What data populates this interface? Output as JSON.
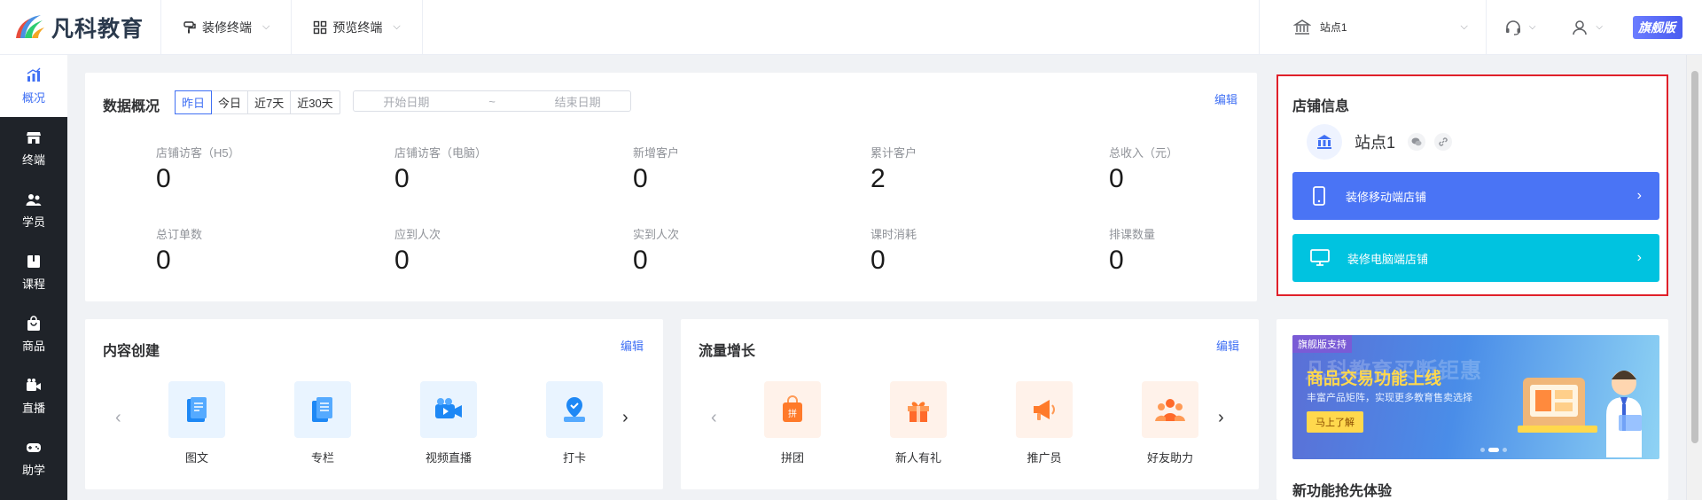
{
  "topbar": {
    "logo_text": "凡科教育",
    "menu_decorate": "装修终端",
    "menu_preview": "预览终端",
    "site": "站点1",
    "vip": "旗舰版"
  },
  "sidebar": {
    "items": [
      {
        "label": "概况",
        "icon": "chart-icon"
      },
      {
        "label": "终端",
        "icon": "store-icon"
      },
      {
        "label": "学员",
        "icon": "users-icon"
      },
      {
        "label": "课程",
        "icon": "book-icon"
      },
      {
        "label": "商品",
        "icon": "bag-icon"
      },
      {
        "label": "直播",
        "icon": "video-icon"
      },
      {
        "label": "助学",
        "icon": "gamepad-icon"
      }
    ]
  },
  "overview": {
    "title": "数据概况",
    "edit": "编辑",
    "ranges": [
      "昨日",
      "今日",
      "近7天",
      "近30天"
    ],
    "active_range": "昨日",
    "start_placeholder": "开始日期",
    "separator": "~",
    "end_placeholder": "结束日期",
    "stats": [
      {
        "label": "店铺访客（H5）",
        "value": "0"
      },
      {
        "label": "店铺访客（电脑）",
        "value": "0"
      },
      {
        "label": "新增客户",
        "value": "0"
      },
      {
        "label": "累计客户",
        "value": "2"
      },
      {
        "label": "总收入（元）",
        "value": "0"
      },
      {
        "label": "总订单数",
        "value": "0"
      },
      {
        "label": "应到人次",
        "value": "0"
      },
      {
        "label": "实到人次",
        "value": "0"
      },
      {
        "label": "课时消耗",
        "value": "0"
      },
      {
        "label": "排课数量",
        "value": "0"
      }
    ]
  },
  "store": {
    "title": "店铺信息",
    "name": "站点1",
    "mobile_btn": "装修移动端店铺",
    "pc_btn": "装修电脑端店铺"
  },
  "content": {
    "title": "内容创建",
    "edit": "编辑",
    "items": [
      {
        "label": "图文",
        "icon": "article-icon"
      },
      {
        "label": "专栏",
        "icon": "column-icon"
      },
      {
        "label": "视频直播",
        "icon": "video-live-icon"
      },
      {
        "label": "打卡",
        "icon": "checkin-icon"
      }
    ]
  },
  "traffic": {
    "title": "流量增长",
    "edit": "编辑",
    "items": [
      {
        "label": "拼团",
        "icon": "group-buy-icon"
      },
      {
        "label": "新人有礼",
        "icon": "gift-icon"
      },
      {
        "label": "推广员",
        "icon": "megaphone-icon"
      },
      {
        "label": "好友助力",
        "icon": "friends-icon"
      }
    ]
  },
  "promo": {
    "tag": "旗舰版支持",
    "ghost": "凡科教育买断钜惠",
    "headline": "商品交易功能上线",
    "sub": "丰富产品矩阵，实现更多教育售卖选择",
    "cta": "马上了解",
    "title": "新功能抢先体验"
  },
  "colors": {
    "accent": "#4070f4",
    "mobile_btn": "#4a74f5",
    "pc_btn": "#00c3e0",
    "highlight_border": "#e0202a",
    "sidebar_bg": "#1f2329"
  }
}
